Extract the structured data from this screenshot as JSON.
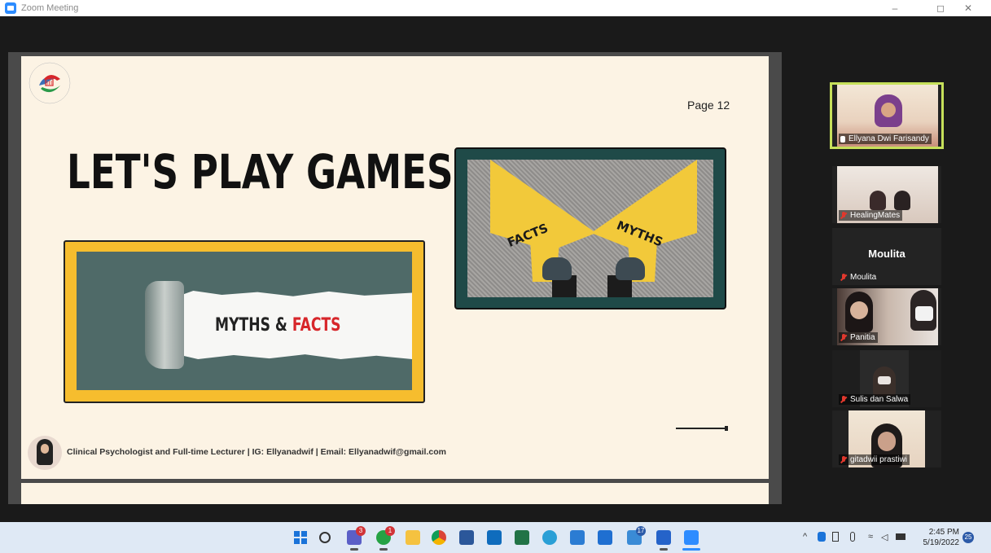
{
  "window": {
    "title": "Zoom Meeting",
    "controls": [
      "–",
      "◻",
      "✕"
    ]
  },
  "slide": {
    "page_label": "Page 12",
    "heading": "LET'S PLAY GAMES!",
    "box_left_text": {
      "part1": "MYTHS & ",
      "part2": "FACTS"
    },
    "arrow_left": "FACTS",
    "arrow_right": "MYTHS",
    "footer": "Clinical Psychologist and Full-time Lecturer | IG: Ellyanadwif | Email: Ellyanadwif@gmail.com",
    "accent_colors": {
      "yellow": "#f6bd2e",
      "teal": "#1f4a48",
      "red": "#d7262a",
      "background": "#fcf3e4"
    }
  },
  "participants": [
    {
      "name": "Ellyana Dwi Farisandy",
      "active_speaker": true,
      "video": true
    },
    {
      "name": "HealingMates",
      "video": true
    },
    {
      "name": "Moulita",
      "video": false,
      "display_name_large": "Moulita"
    },
    {
      "name": "Panitia",
      "video": true
    },
    {
      "name": "Sulis dan Salwa",
      "video": true
    },
    {
      "name": "gitadwii prastiwi",
      "video": true
    }
  ],
  "taskbar": {
    "badges": {
      "teams": "3",
      "whatsapp": "1",
      "app_17": "17"
    },
    "clock_time": "2:45 PM",
    "clock_date": "5/19/2022",
    "notification_count": "25"
  }
}
